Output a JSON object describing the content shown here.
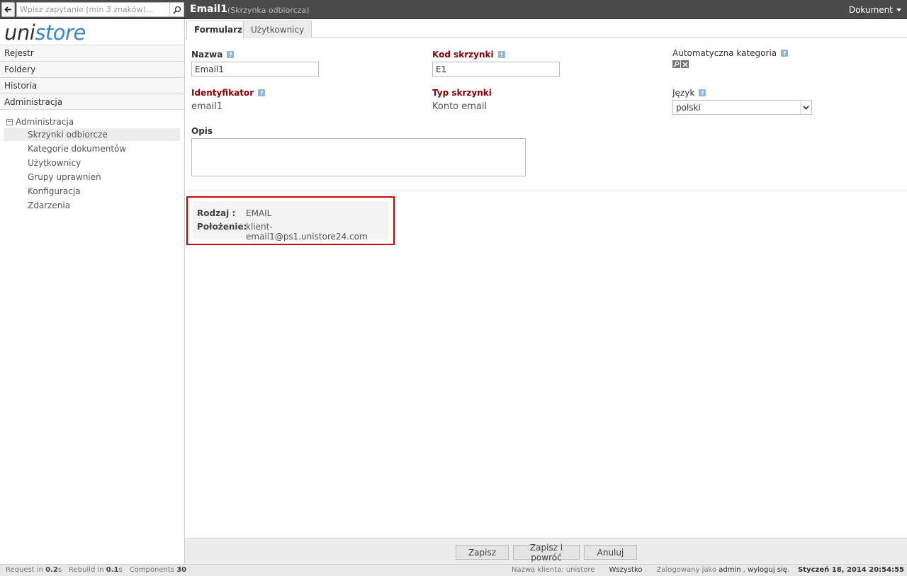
{
  "topbar": {
    "search_placeholder": "Wpisz zapytanie (min 3 znaków)...",
    "doc_title": "Email1",
    "doc_subtitle": "(Skrzynka odbiorcza)",
    "doc_menu_label": "Dokument"
  },
  "logo": {
    "part1": "uni",
    "part2": "store"
  },
  "sidebar": {
    "nav": [
      "Rejestr",
      "Foldery",
      "Historia",
      "Administracja"
    ],
    "tree_root": "Administracja",
    "tree_toggle": "−",
    "tree_items": [
      "Skrzynki odbiorcze",
      "Kategorie dokumentów",
      "Użytkownicy",
      "Grupy uprawnień",
      "Konfiguracja",
      "Zdarzenia"
    ]
  },
  "tabs": [
    "Formularz",
    "Użytkownicy"
  ],
  "form": {
    "help_glyph": "?",
    "name_label": "Nazwa",
    "name_value": "Email1",
    "code_label": "Kod skrzynki",
    "code_value": "E1",
    "autocat_label": "Automatyczna kategoria",
    "id_label": "Identyfikator",
    "id_value": "email1",
    "type_label": "Typ skrzynki",
    "type_value": "Konto email",
    "lang_label": "Język",
    "lang_value": "polski",
    "desc_label": "Opis"
  },
  "info": {
    "kind_key": "Rodzaj :",
    "kind_value": "EMAIL",
    "location_key": "Położenie:",
    "location_value": "klient-email1@ps1.unistore24.com"
  },
  "buttons": {
    "save": "Zapisz",
    "save_return": "Zapisz i powróć",
    "cancel": "Anuluj"
  },
  "status": {
    "request_label": "Request in",
    "request_value": "0.2",
    "request_unit": "s",
    "rebuild_label": "Rebuild in",
    "rebuild_value": "0.1",
    "rebuild_unit": "s",
    "components_label": "Components",
    "components_value": "30",
    "client": "Nazwa klienta: unistore",
    "scope": "Wszystko",
    "logged_as": "Zalogowany jako",
    "user": "admin",
    "comma": ",",
    "logout": "wyloguj się",
    "period": ".",
    "datetime": "Styczeń 18, 2014 20:54:55"
  }
}
